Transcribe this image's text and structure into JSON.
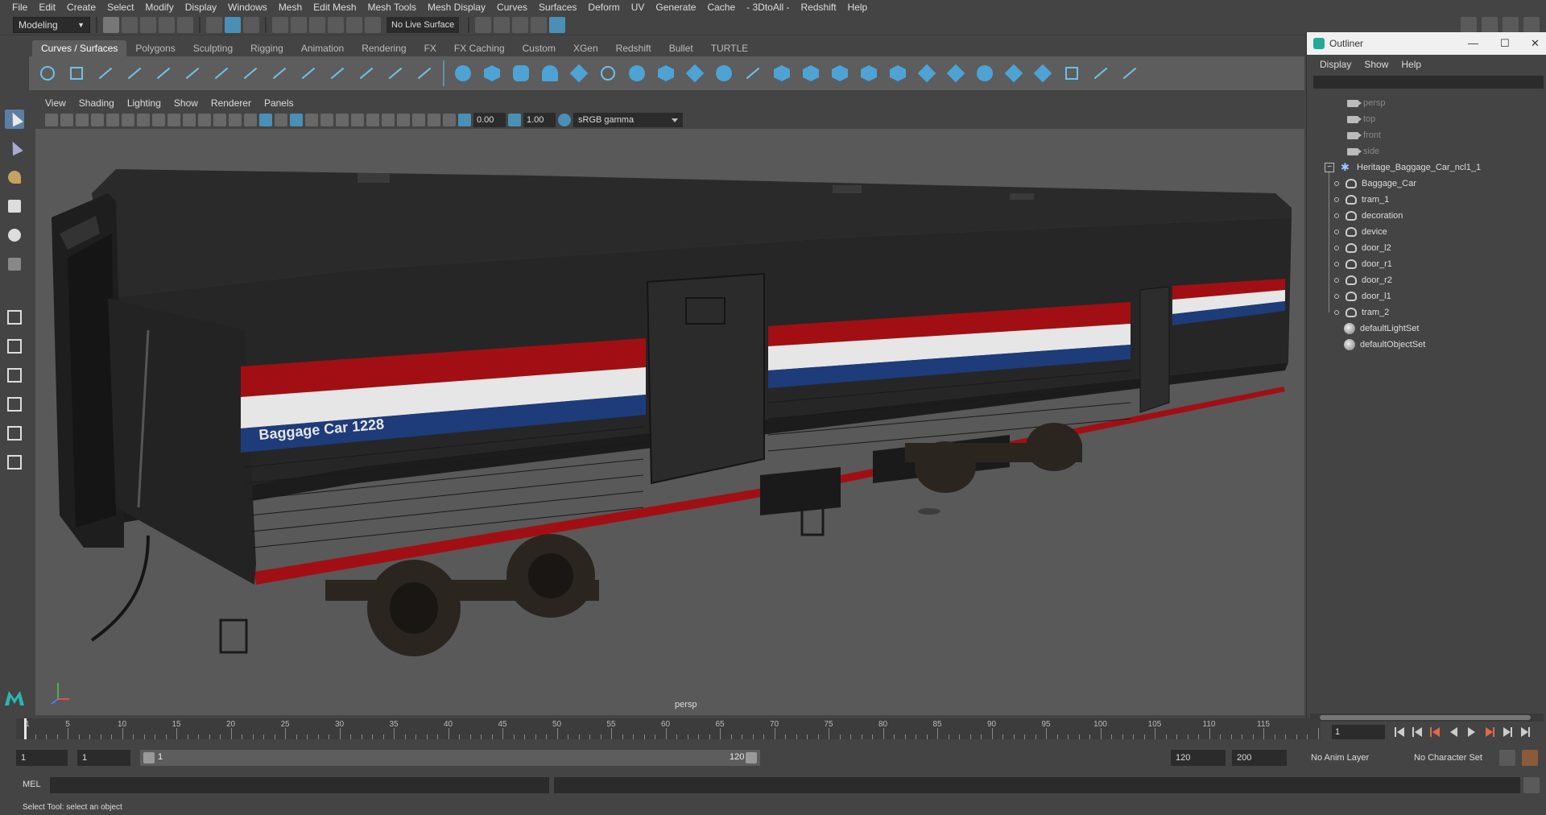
{
  "menu": [
    "File",
    "Edit",
    "Create",
    "Select",
    "Modify",
    "Display",
    "Windows",
    "Mesh",
    "Edit Mesh",
    "Mesh Tools",
    "Mesh Display",
    "Curves",
    "Surfaces",
    "Deform",
    "UV",
    "Generate",
    "Cache",
    "- 3DtoAll -",
    "Redshift",
    "Help"
  ],
  "status_line": {
    "mode": "Modeling",
    "live_surface": "No Live Surface"
  },
  "shelf_tabs": [
    "Curves / Surfaces",
    "Polygons",
    "Sculpting",
    "Rigging",
    "Animation",
    "Rendering",
    "FX",
    "FX Caching",
    "Custom",
    "XGen",
    "Redshift",
    "Bullet",
    "TURTLE"
  ],
  "viewport": {
    "menu": [
      "View",
      "Shading",
      "Lighting",
      "Show",
      "Renderer",
      "Panels"
    ],
    "exposure": "0.00",
    "gamma_value": "1.00",
    "color_space": "sRGB gamma",
    "camera_label": "persp",
    "car_text": "Baggage Car 1228"
  },
  "outliner": {
    "title": "Outliner",
    "menu": [
      "Display",
      "Show",
      "Help"
    ],
    "cameras": [
      "persp",
      "top",
      "front",
      "side"
    ],
    "group": "Heritage_Baggage_Car_ncl1_1",
    "children": [
      "Baggage_Car",
      "tram_1",
      "decoration",
      "device",
      "door_l2",
      "door_r1",
      "door_r2",
      "door_l1",
      "tram_2"
    ],
    "sets": [
      "defaultLightSet",
      "defaultObjectSet"
    ]
  },
  "timeline": {
    "ticks": [
      "5",
      "10",
      "15",
      "20",
      "25",
      "30",
      "35",
      "40",
      "45",
      "50",
      "55",
      "60",
      "65",
      "70",
      "75",
      "80",
      "85",
      "90",
      "95",
      "100",
      "105",
      "110",
      "115"
    ],
    "start_tick": "1",
    "current_frame": "1"
  },
  "range": {
    "start": "1",
    "playback_start": "1",
    "slider_start": "1",
    "slider_end": "120",
    "playback_end": "120",
    "end": "200",
    "anim_layer": "No Anim Layer",
    "character_set": "No Character Set"
  },
  "command": {
    "label": "MEL"
  },
  "help_line": "Select Tool: select an object",
  "colors": {
    "stripe_red": "#a10f14",
    "stripe_white": "#e6e6e6",
    "stripe_blue": "#1e3c7a",
    "viewport_bg": "#595959"
  }
}
